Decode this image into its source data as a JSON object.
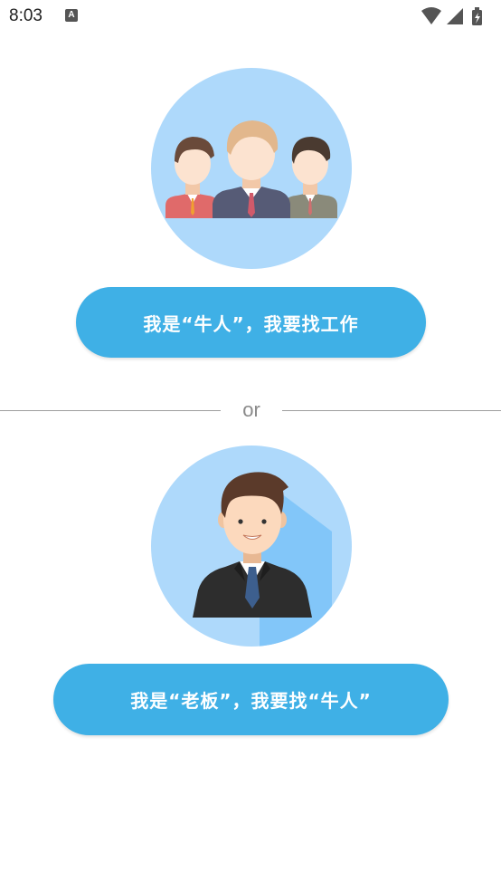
{
  "status_bar": {
    "time": "8:03",
    "notification_glyph": "A",
    "icons": [
      "wifi-icon",
      "signal-icon",
      "battery-charging-icon"
    ]
  },
  "options": [
    {
      "illustration": "group-of-people-icon",
      "label": "我是“牛人”，我要找工作"
    },
    {
      "illustration": "businessman-icon",
      "label": "我是“老板”，我要找“牛人”"
    }
  ],
  "divider": {
    "text": "or"
  },
  "colors": {
    "button": "#3fb0e6",
    "avatar_bg": "#aed9fb",
    "divider": "#9e9e9e"
  }
}
